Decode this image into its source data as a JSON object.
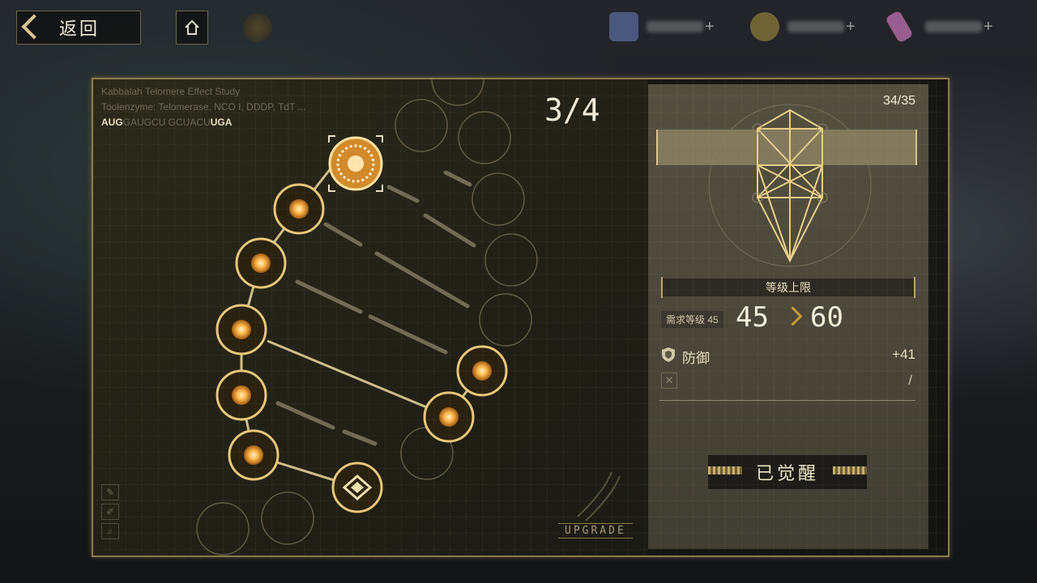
{
  "topbar": {
    "back_label": "返回",
    "resources": [
      {
        "icon": "ticket-icon",
        "color": "#5a6a9a",
        "plus": "+"
      },
      {
        "icon": "gold-coin-icon",
        "color": "#8a7a3a",
        "plus": "+"
      },
      {
        "icon": "crystal-icon",
        "color": "#c070b0",
        "plus": "+"
      }
    ]
  },
  "study": {
    "title": "Kabbalah Telomere Effect Study",
    "enzyme": "Toolenzyme: Telomerase, NCO I, DDDP, TdT ...",
    "seq_start": "AUG",
    "seq_mid": "GAUGCU GCUACU",
    "seq_end": "UGA"
  },
  "progress": "3/4",
  "upgrade_label": "UPGRADE",
  "panel": {
    "level_count": "34/35",
    "cap_title": "等级上限",
    "req_label": "需求等级 45",
    "level_from": "45",
    "level_to": "60",
    "stat_name": "防御",
    "stat_value": "+41",
    "slash": "/",
    "awakened_label": "已觉醒"
  },
  "colors": {
    "accent": "#d9c591",
    "node_core": "#ffb84d"
  }
}
